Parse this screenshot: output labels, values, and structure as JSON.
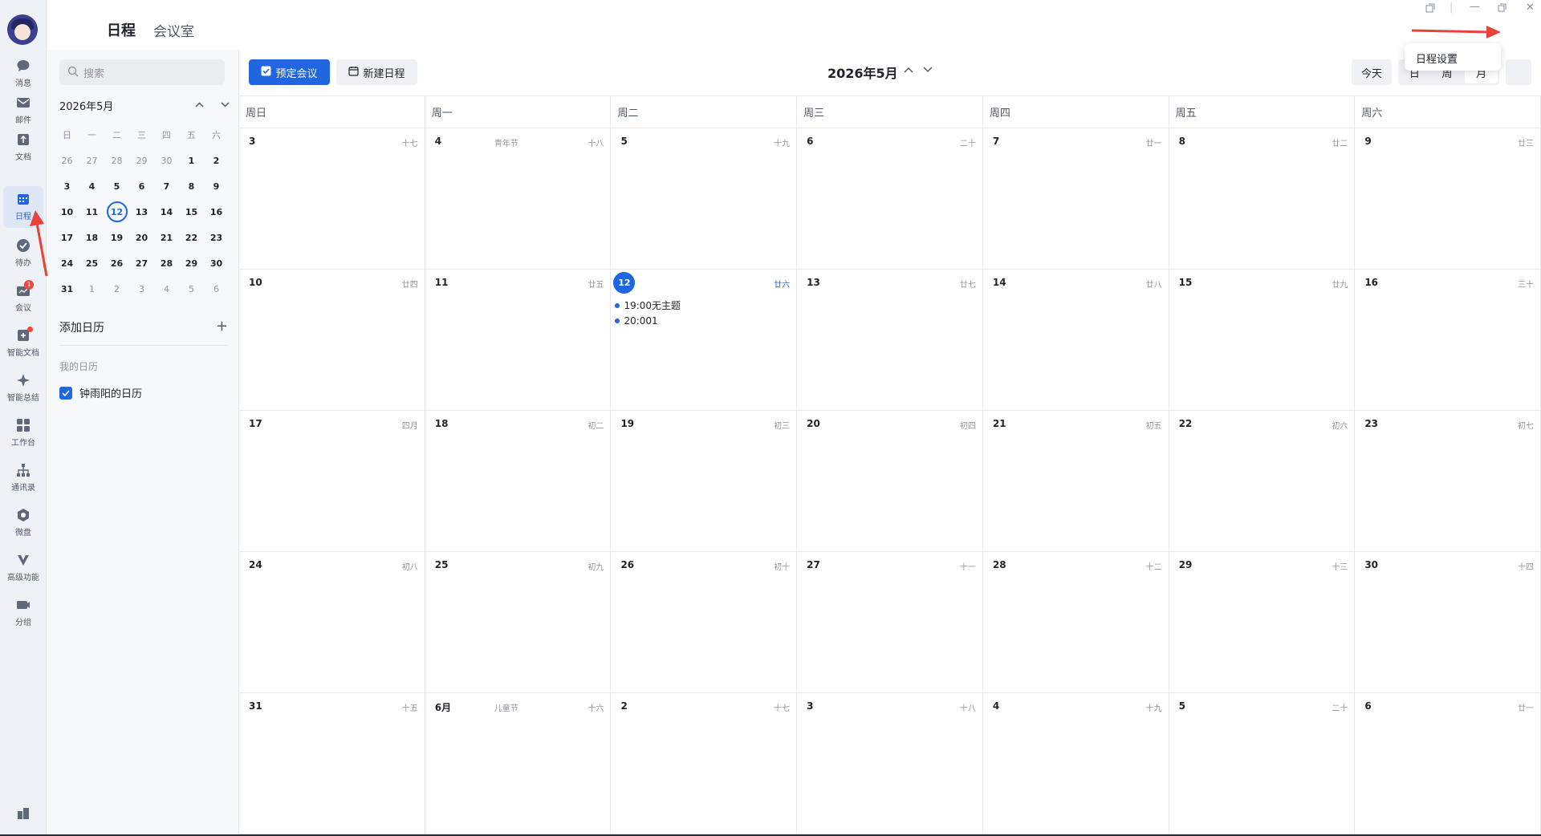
{
  "topbar": {
    "title": "日程",
    "tab_meeting_room": "会议室",
    "more_label": "···"
  },
  "rail": {
    "items": [
      {
        "label": "消息"
      },
      {
        "label": "邮件"
      },
      {
        "label": "文档"
      },
      {
        "label": "日程"
      },
      {
        "label": "待办"
      },
      {
        "label": "会议",
        "badge": "1"
      },
      {
        "label": "智能文档"
      },
      {
        "label": "智能总结"
      },
      {
        "label": "工作台"
      },
      {
        "label": "通讯录"
      },
      {
        "label": "微盘"
      },
      {
        "label": "高级功能"
      },
      {
        "label": "分组"
      }
    ]
  },
  "sidebar": {
    "search_placeholder": "搜索",
    "mini_month": "2026年5月",
    "weekdays": [
      "日",
      "一",
      "二",
      "三",
      "四",
      "五",
      "六"
    ],
    "weeks": [
      [
        "26",
        "27",
        "28",
        "29",
        "30",
        "1",
        "2"
      ],
      [
        "3",
        "4",
        "5",
        "6",
        "7",
        "8",
        "9"
      ],
      [
        "10",
        "11",
        "12",
        "13",
        "14",
        "15",
        "16"
      ],
      [
        "17",
        "18",
        "19",
        "20",
        "21",
        "22",
        "23"
      ],
      [
        "24",
        "25",
        "26",
        "27",
        "28",
        "29",
        "30"
      ],
      [
        "31",
        "1",
        "2",
        "3",
        "4",
        "5",
        "6"
      ]
    ],
    "add_calendar": "添加日历",
    "my_calendars": "我的日历",
    "calendar_name": "钟雨阳的日历"
  },
  "toolbar": {
    "book_meeting": "预定会议",
    "new_event": "新建日程",
    "month_title": "2026年5月",
    "today": "今天",
    "views": [
      "日",
      "周",
      "月"
    ]
  },
  "calendar": {
    "weekdays": [
      "周日",
      "周一",
      "周二",
      "周三",
      "周四",
      "周五",
      "周六"
    ],
    "weeks": [
      [
        {
          "d": "3",
          "l": "十七"
        },
        {
          "d": "4",
          "l": "十八",
          "f": "青年节"
        },
        {
          "d": "5",
          "l": "十九"
        },
        {
          "d": "6",
          "l": "二十"
        },
        {
          "d": "7",
          "l": "廿一"
        },
        {
          "d": "8",
          "l": "廿二"
        },
        {
          "d": "9",
          "l": "廿三"
        }
      ],
      [
        {
          "d": "10",
          "l": "廿四"
        },
        {
          "d": "11",
          "l": "廿五"
        },
        {
          "d": "12",
          "l": "廿六",
          "today": true
        },
        {
          "d": "13",
          "l": "廿七"
        },
        {
          "d": "14",
          "l": "廿八"
        },
        {
          "d": "15",
          "l": "廿九"
        },
        {
          "d": "16",
          "l": "三十"
        }
      ],
      [
        {
          "d": "17",
          "l": "四月"
        },
        {
          "d": "18",
          "l": "初二"
        },
        {
          "d": "19",
          "l": "初三"
        },
        {
          "d": "20",
          "l": "初四"
        },
        {
          "d": "21",
          "l": "初五"
        },
        {
          "d": "22",
          "l": "初六"
        },
        {
          "d": "23",
          "l": "初七"
        }
      ],
      [
        {
          "d": "24",
          "l": "初八"
        },
        {
          "d": "25",
          "l": "初九"
        },
        {
          "d": "26",
          "l": "初十"
        },
        {
          "d": "27",
          "l": "十一"
        },
        {
          "d": "28",
          "l": "十二"
        },
        {
          "d": "29",
          "l": "十三"
        },
        {
          "d": "30",
          "l": "十四"
        }
      ],
      [
        {
          "d": "31",
          "l": "十五"
        },
        {
          "d": "6月",
          "l": "十六",
          "f": "儿童节"
        },
        {
          "d": "2",
          "l": "十七"
        },
        {
          "d": "3",
          "l": "十八"
        },
        {
          "d": "4",
          "l": "十九"
        },
        {
          "d": "5",
          "l": "二十"
        },
        {
          "d": "6",
          "l": "廿一"
        }
      ]
    ],
    "events": [
      {
        "time": "19:00",
        "title": "无主题"
      },
      {
        "time": "20:00",
        "title": "1"
      }
    ]
  },
  "dropdown": {
    "item": "日程设置"
  },
  "colors": {
    "accent": "#1f66e0",
    "annotation_arrow": "#e8423a",
    "badge": "#f2453d"
  }
}
